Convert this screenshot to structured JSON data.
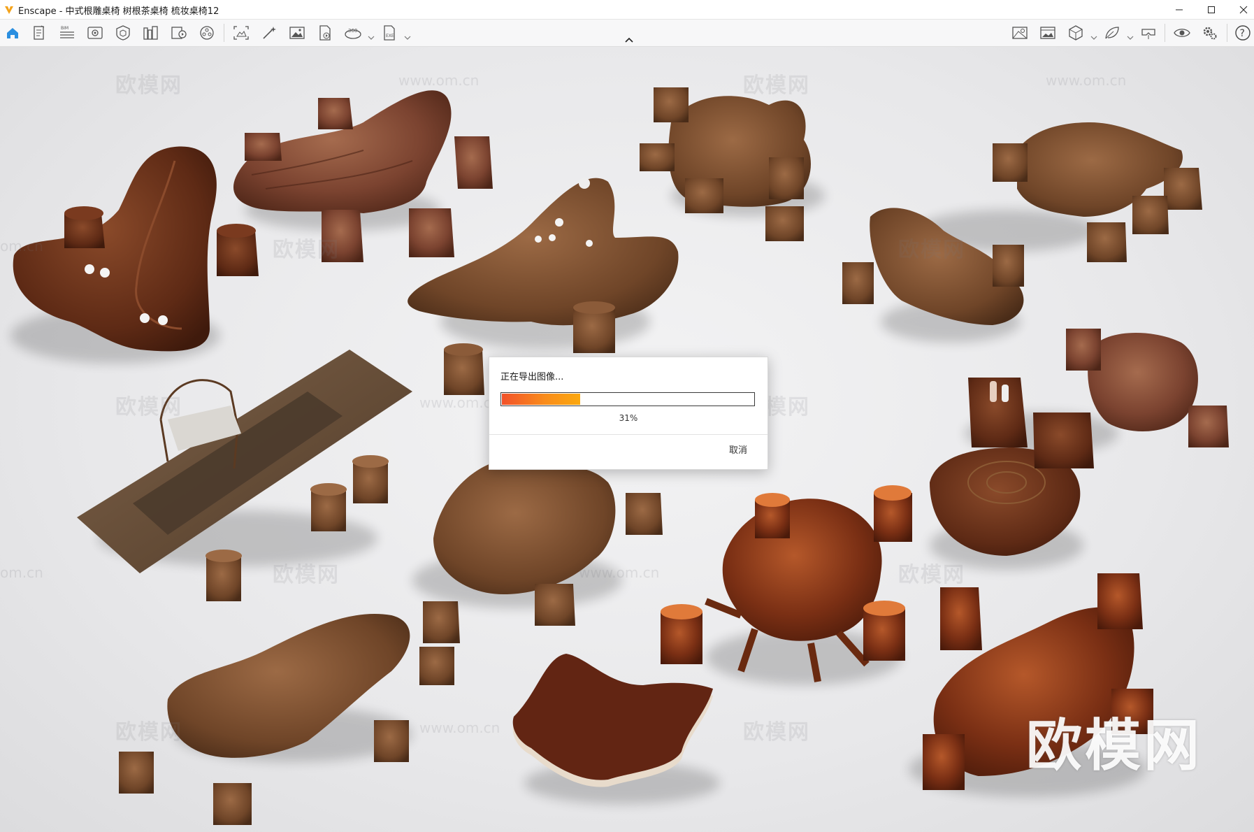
{
  "window": {
    "app_name": "Enscape",
    "title": "Enscape - 中式根雕桌椅 树根茶桌椅 梳妆桌椅12",
    "controls": [
      "minimize-icon",
      "maximize-icon",
      "close-icon"
    ]
  },
  "toolbar": {
    "left_icons": [
      "home-icon",
      "document-icon",
      "bim-list-icon",
      "view-icon",
      "cube-shield-icon",
      "library-icon",
      "video-book-icon",
      "pano-circle-icon",
      "screenshot-icon",
      "magic-wand-icon",
      "image-export-icon",
      "pdf-export-icon",
      "panorama-360-icon",
      "exe-export-icon"
    ],
    "right_icons": [
      "map-pin-icon",
      "image-icon",
      "cube-icon",
      "leaf-icon",
      "vr-headset-icon",
      "eye-icon",
      "settings-gears-icon",
      "help-icon"
    ],
    "collapse_icon": "chevron-up-icon"
  },
  "viewport": {
    "watermarks": [
      "欧模网",
      "www.om.cn",
      "om.cn"
    ],
    "brand_watermark": "欧模网"
  },
  "export_dialog": {
    "title": "正在导出图像...",
    "progress_percent": 31,
    "progress_label": "31%",
    "cancel_label": "取消",
    "progress_colors": [
      "#f2522a",
      "#fba80e"
    ]
  }
}
